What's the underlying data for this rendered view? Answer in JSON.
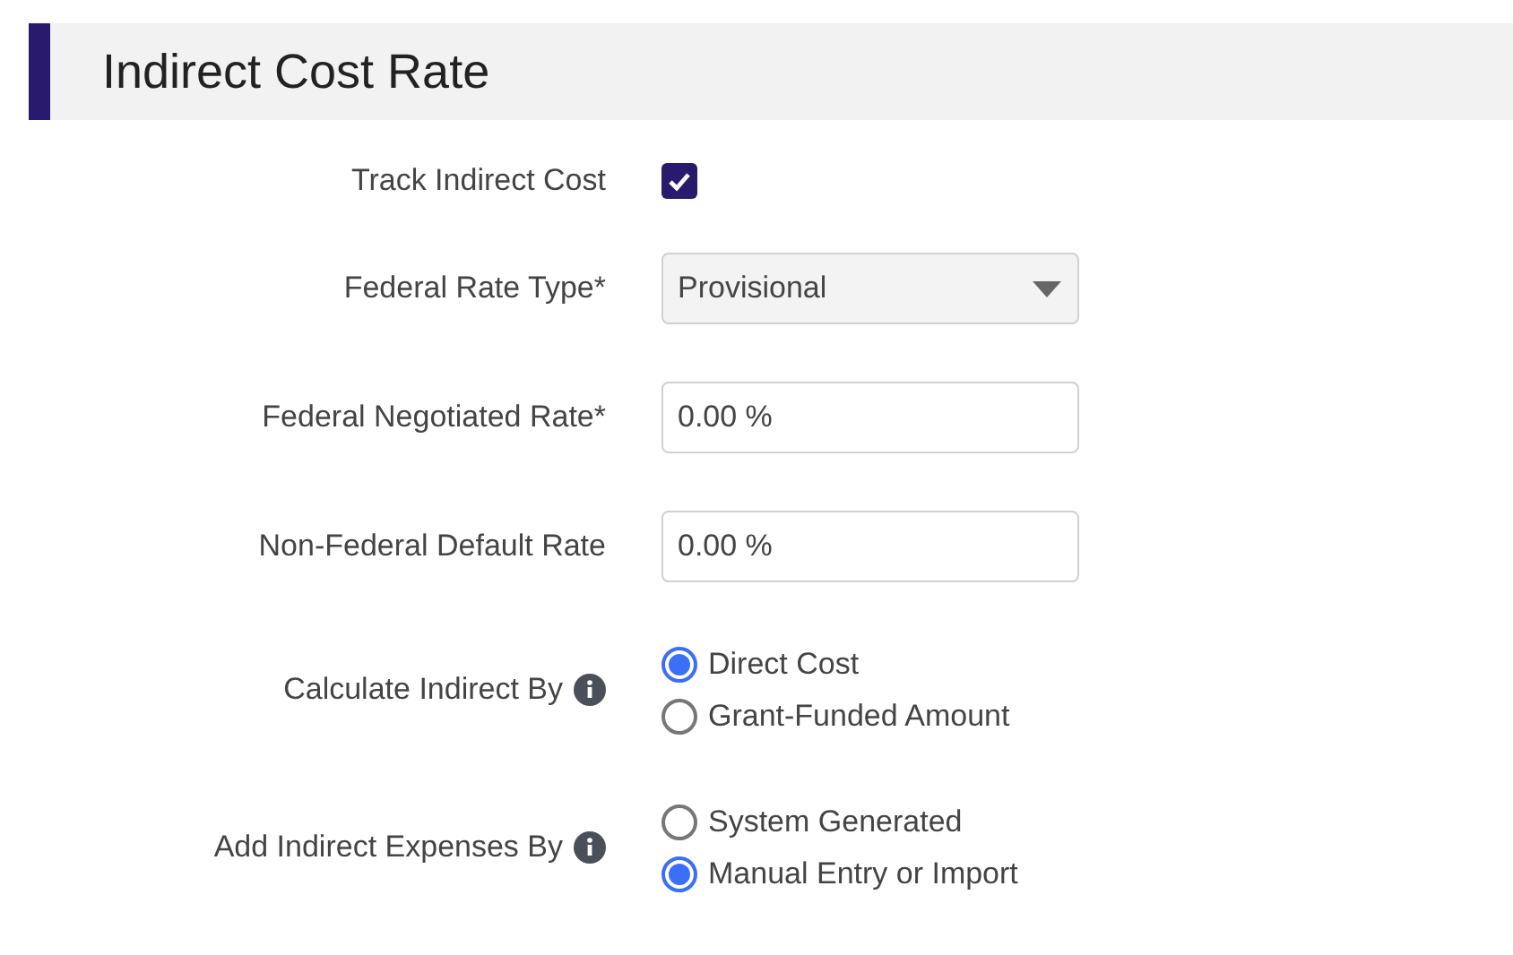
{
  "section": {
    "title": "Indirect Cost Rate"
  },
  "fields": [
    {
      "kind": "checkbox",
      "label": "Track Indirect Cost",
      "info": false,
      "checked": true
    },
    {
      "kind": "select",
      "label": "Federal Rate Type*",
      "info": false,
      "value": "Provisional"
    },
    {
      "kind": "input",
      "label": "Federal Negotiated Rate*",
      "info": false,
      "value": "0.00 %"
    },
    {
      "kind": "input",
      "label": "Non-Federal Default Rate",
      "info": false,
      "value": "0.00 %"
    },
    {
      "kind": "radio",
      "label": "Calculate Indirect By",
      "info": true,
      "options": [
        {
          "label": "Direct Cost",
          "selected": true
        },
        {
          "label": "Grant-Funded Amount",
          "selected": false
        }
      ]
    },
    {
      "kind": "radio",
      "label": "Add Indirect Expenses By",
      "info": true,
      "options": [
        {
          "label": "System Generated",
          "selected": false
        },
        {
          "label": "Manual Entry or Import",
          "selected": true
        }
      ]
    }
  ]
}
